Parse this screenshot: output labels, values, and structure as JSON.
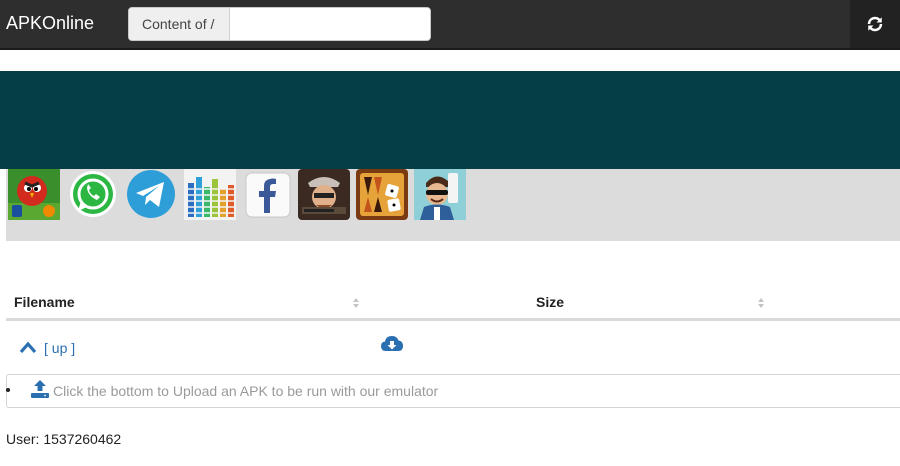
{
  "header": {
    "brand": "APKOnline",
    "content_label": "Content of /",
    "content_value": "",
    "refresh_icon": "refresh-icon"
  },
  "apps": [
    {
      "name": "Angry Birds Rio"
    },
    {
      "name": "WhatsApp"
    },
    {
      "name": "Telegram"
    },
    {
      "name": "Equalizer"
    },
    {
      "name": "Facebook"
    },
    {
      "name": "Shooter game"
    },
    {
      "name": "Backgammon"
    },
    {
      "name": "Agent game"
    }
  ],
  "table": {
    "columns": [
      "Filename",
      "Size"
    ],
    "up_label": "[ up ]"
  },
  "upload": {
    "text": "Click the bottom to Upload an APK to be run with our emulator"
  },
  "user": {
    "label": "User: 1537260462"
  },
  "colors": {
    "topbar": "#2e2e2e",
    "banner": "#063e46",
    "strip": "#dcdcdc",
    "link": "#2a6fb0"
  }
}
